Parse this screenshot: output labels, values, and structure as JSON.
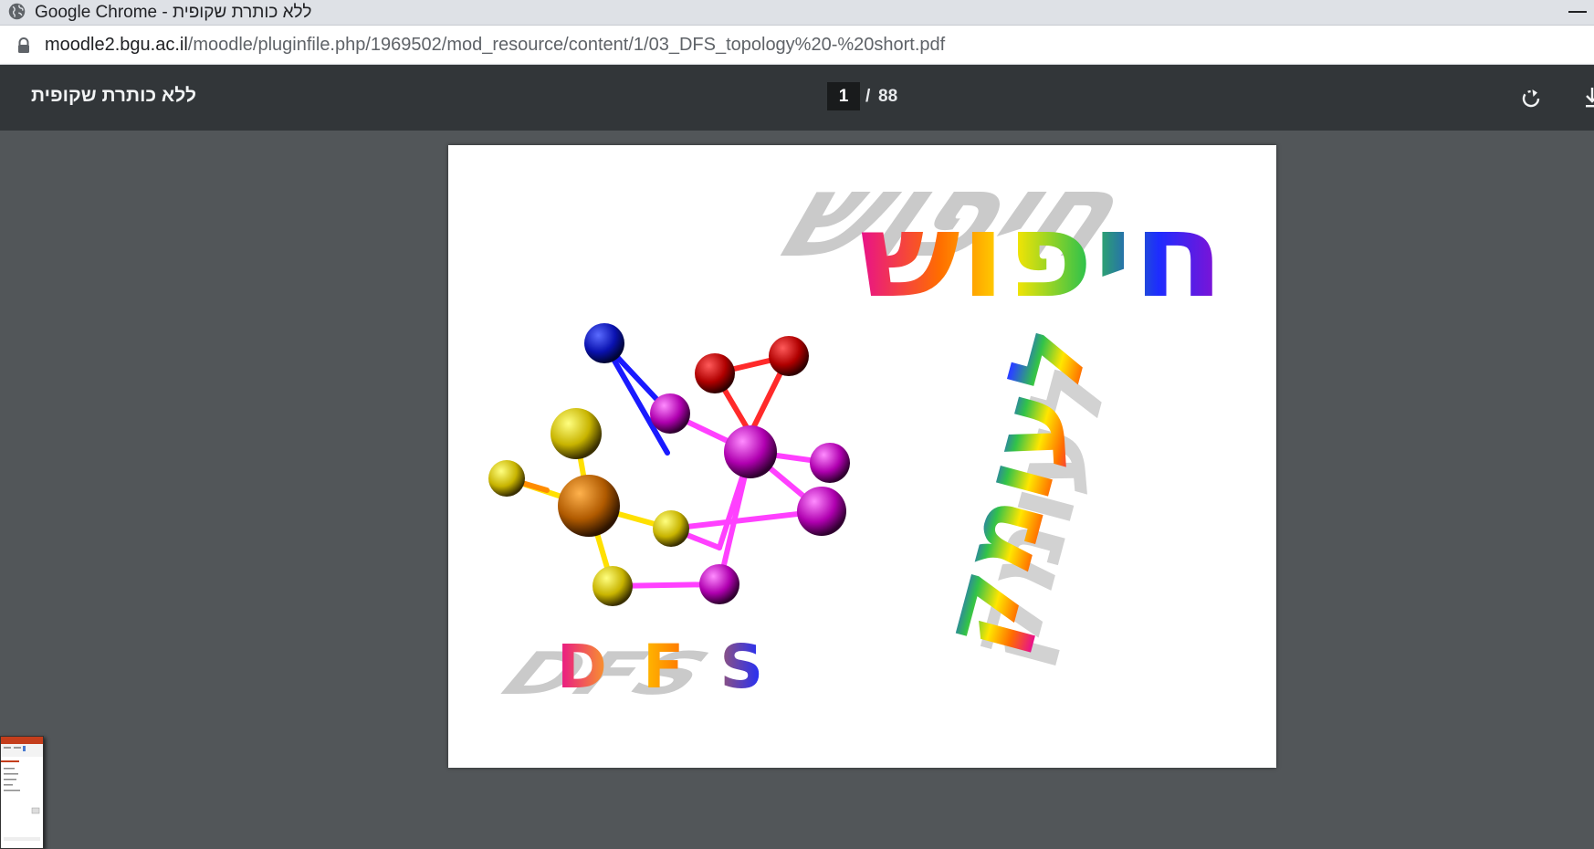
{
  "window": {
    "title": "Google Chrome - ללא כותרת שקופית"
  },
  "address_bar": {
    "host": "moodle2.bgu.ac.il",
    "path": "/moodle/pluginfile.php/1969502/mod_resource/content/1/03_DFS_topology%20-%20short.pdf"
  },
  "pdf_toolbar": {
    "document_title": "ללא כותרת שקופית",
    "current_page": "1",
    "separator": "/",
    "total_pages": "88"
  },
  "slide": {
    "heading_word": "חיפוש",
    "vertical_word": "לעומק",
    "logo_text": "DFS"
  },
  "icons": [
    "globe-icon",
    "lock-icon",
    "rotate-icon",
    "download-icon",
    "minimize-icon"
  ]
}
